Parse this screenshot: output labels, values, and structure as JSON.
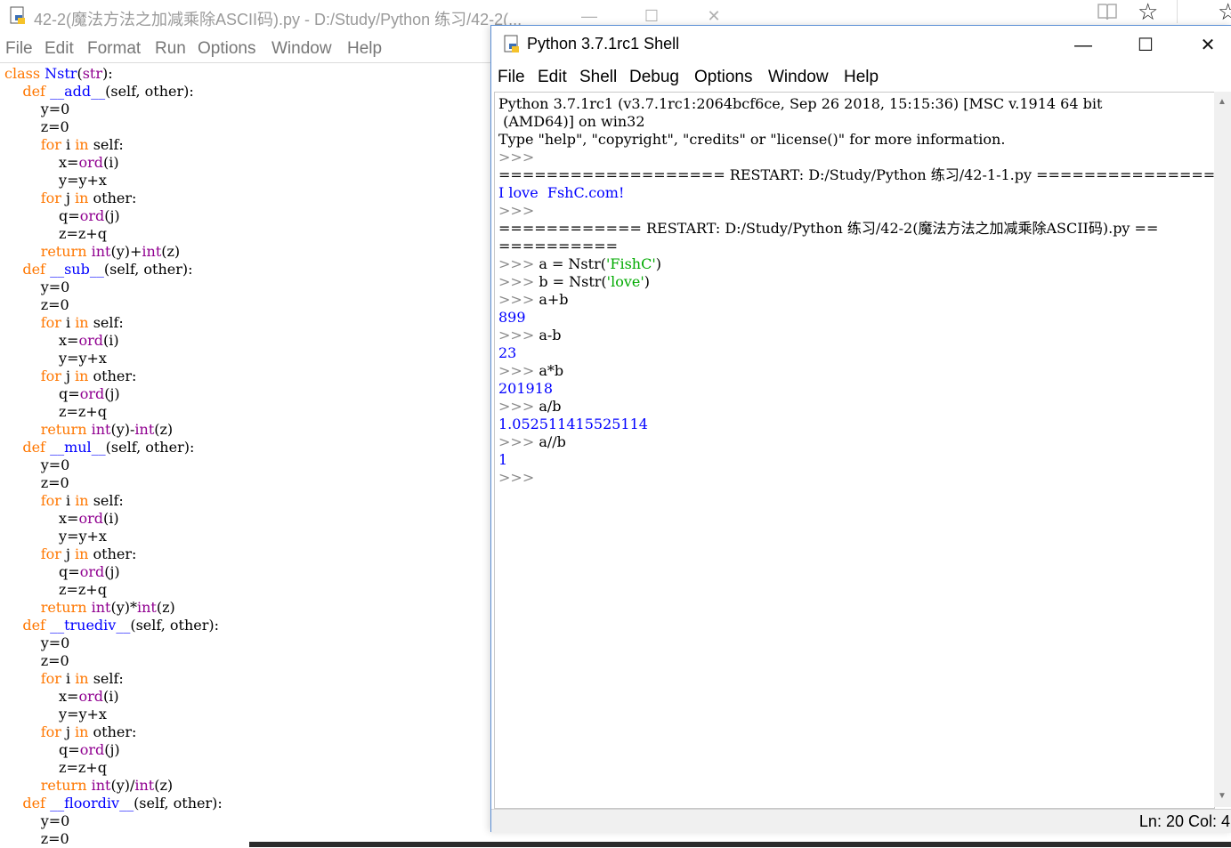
{
  "editor": {
    "title": "42-2(魔法方法之加减乘除ASCII码).py - D:/Study/Python 练习/42-2(...",
    "controls": {
      "minimize": "—",
      "maximize": "☐",
      "close": "✕"
    },
    "menu": [
      "File",
      "Edit",
      "Format",
      "Run",
      "Options",
      "Window",
      "Help"
    ]
  },
  "top_bar": {
    "star": "☆",
    "star2": "☆"
  },
  "shell": {
    "title": "Python 3.7.1rc1 Shell",
    "controls": {
      "minimize": "—",
      "maximize": "☐",
      "close": "✕"
    },
    "menu": [
      "File",
      "Edit",
      "Shell",
      "Debug",
      "Options",
      "Window",
      "Help"
    ],
    "status": "Ln: 20  Col: 4"
  }
}
